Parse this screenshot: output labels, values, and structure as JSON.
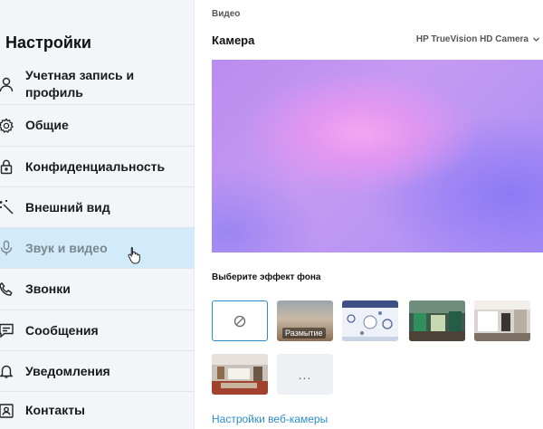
{
  "sidebar": {
    "title": "Настройки",
    "items": [
      {
        "label": "Учетная запись и профиль",
        "icon": "person-icon"
      },
      {
        "label": "Общие",
        "icon": "gear-icon"
      },
      {
        "label": "Конфиденциальность",
        "icon": "lock-icon"
      },
      {
        "label": "Внешний вид",
        "icon": "magic-wand-icon"
      },
      {
        "label": "Звук и видео",
        "icon": "microphone-icon",
        "active": true
      },
      {
        "label": "Звонки",
        "icon": "phone-icon"
      },
      {
        "label": "Сообщения",
        "icon": "message-icon"
      },
      {
        "label": "Уведомления",
        "icon": "bell-icon"
      },
      {
        "label": "Контакты",
        "icon": "contacts-icon"
      }
    ]
  },
  "main": {
    "section_label": "Видео",
    "camera_title": "Камера",
    "camera_device": "HP TrueVision HD Camera",
    "background_label": "Выберите эффект фона",
    "blur_label": "Размытие",
    "more_label": "...",
    "webcam_settings_link": "Настройки веб-камеры"
  },
  "colors": {
    "accent": "#2b8ccd",
    "active_nav": "#d1ebfb",
    "sidebar_bg": "#f3f6f9"
  }
}
